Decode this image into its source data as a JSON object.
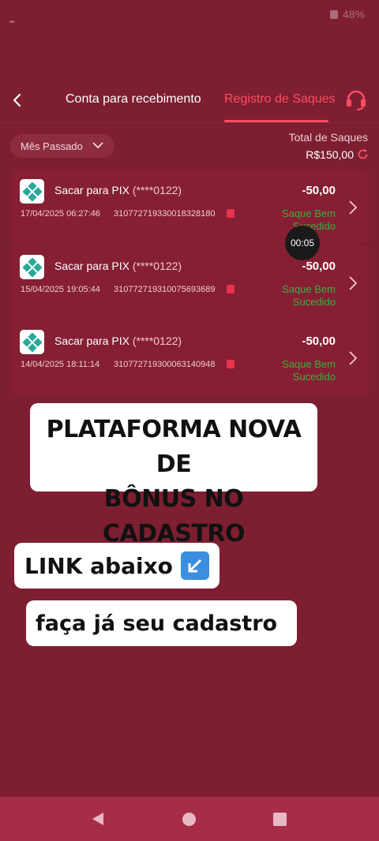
{
  "status_bar": {
    "battery": "48%"
  },
  "nav": {
    "tab_receiving": "Conta para recebimento",
    "tab_withdrawals": "Registro de Saques"
  },
  "filter": {
    "label": "Mês Passado"
  },
  "total": {
    "label": "Total de Saques",
    "value": "R$150,00"
  },
  "records": [
    {
      "title": "Sacar para PIX",
      "account": "(****0122)",
      "date": "17/04/2025 06:27:46",
      "txid": "310772719330018328180",
      "amount": "-50,00",
      "status": "Saque Bem Sucedido"
    },
    {
      "title": "Sacar para PIX",
      "account": "(****0122)",
      "date": "15/04/2025 19:05:44",
      "txid": "310772719310075693689",
      "amount": "-50,00",
      "status": "Saque Bem Sucedido"
    },
    {
      "title": "Sacar para PIX",
      "account": "(****0122)",
      "date": "14/04/2025 18:11:14",
      "txid": "310772719300063140948",
      "amount": "-50,00",
      "status": "Saque Bem Sucedido"
    }
  ],
  "timer": "00:05",
  "overlays": {
    "line1": "PLATAFORMA NOVA DE",
    "line2": "BÔNUS NO CADASTRO",
    "link": "LINK abaixo",
    "cta": "faça já seu cadastro"
  },
  "colors": {
    "accent": "#ff4d63",
    "background": "#7d1e31",
    "success": "#3cae3c"
  }
}
